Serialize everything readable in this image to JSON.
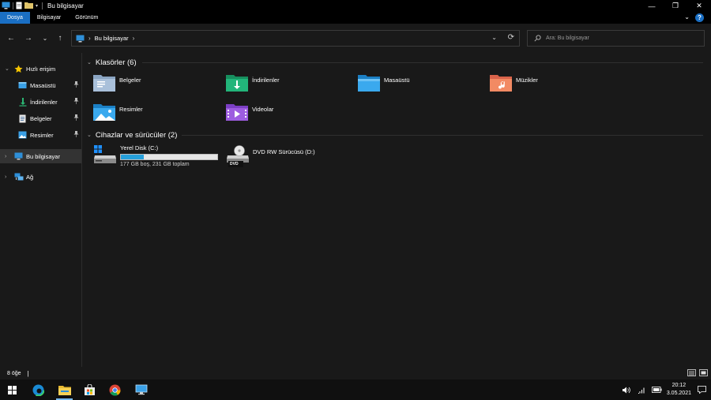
{
  "window": {
    "title": "Bu bilgisayar",
    "controls": {
      "minimize": "—",
      "maximize": "❐",
      "close": "✕"
    }
  },
  "ribbon": {
    "tabs": [
      "Dosya",
      "Bilgisayar",
      "Görünüm"
    ],
    "active_tab": "Dosya",
    "collapse": "⌄",
    "help": "?"
  },
  "navigation": {
    "back": "←",
    "forward": "→",
    "recent": "⌄",
    "up": "↑",
    "address_crumb": "Bu bilgisayar",
    "address_sep": "›",
    "address_dropdown": "⌄",
    "refresh": "⟳",
    "search_placeholder": "Ara: Bu bilgisayar"
  },
  "sidebar": {
    "quick_access": "Hızlı erişim",
    "pinned": [
      {
        "label": "Masaüstü",
        "icon": "desktop-icon"
      },
      {
        "label": "İndirilenler",
        "icon": "download-icon"
      },
      {
        "label": "Belgeler",
        "icon": "documents-icon"
      },
      {
        "label": "Resimler",
        "icon": "pictures-icon"
      }
    ],
    "this_pc": "Bu bilgisayar",
    "network": "Ağ",
    "pin_glyph": "📌"
  },
  "content": {
    "folders_header": "Klasörler (6)",
    "folders": [
      {
        "label": "Belgeler",
        "icon": "documents-folder-icon"
      },
      {
        "label": "İndirilenler",
        "icon": "downloads-folder-icon"
      },
      {
        "label": "Masaüstü",
        "icon": "desktop-folder-icon"
      },
      {
        "label": "Müzikler",
        "icon": "music-folder-icon"
      },
      {
        "label": "Resimler",
        "icon": "pictures-folder-icon"
      },
      {
        "label": "Videolar",
        "icon": "videos-folder-icon"
      }
    ],
    "devices_header": "Cihazlar ve sürücüler (2)",
    "drives": [
      {
        "label": "Yerel Disk (C:)",
        "info": "177 GB boş, 231 GB toplam",
        "used_fraction": 0.234
      },
      {
        "label": "DVD RW Sürücüsü (D:)",
        "badge": "DVD"
      }
    ]
  },
  "status": {
    "count": "8 öğe",
    "cursor": "|"
  },
  "taskbar": {
    "time": "20:12",
    "date": "3.05.2021"
  },
  "colors": {
    "accent": "#1a6fc4",
    "background": "#191919",
    "drive_bar": "#26a0da"
  }
}
